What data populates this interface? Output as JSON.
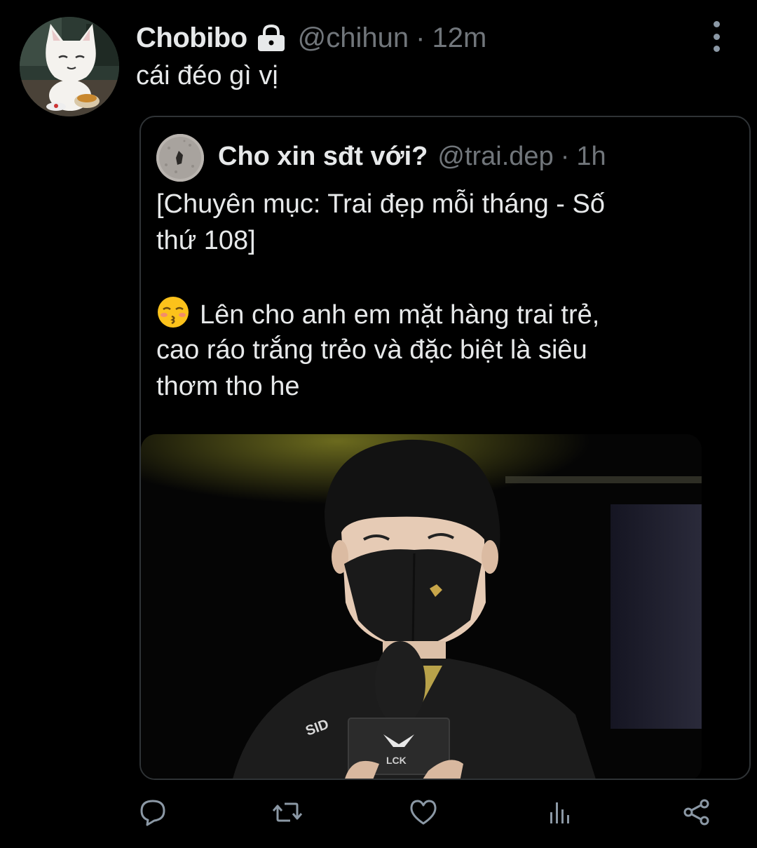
{
  "tweet": {
    "display_name": "Chobibo",
    "handle": "@chihun",
    "separator": "·",
    "time": "12m",
    "text": "cái đéo gì vị",
    "protected_icon": "lock-icon",
    "more_icon": "more-vertical-icon"
  },
  "quoted_tweet": {
    "display_name": "Cho xin sđt với?",
    "handle": "@trai.dep",
    "separator": "·",
    "time": "1h",
    "lines": [
      "[Chuyên mục: Trai đẹp mỗi tháng - Số",
      "thứ 108]",
      "",
      "Lên cho anh em mặt hàng trai trẻ,",
      "cao ráo trắng trẻo và đặc biệt là siêu",
      "thơm tho he"
    ],
    "emoji": "kissing-face-with-closed-eyes",
    "media": "photo"
  },
  "actions": [
    {
      "name": "reply",
      "icon": "reply-icon"
    },
    {
      "name": "retweet",
      "icon": "retweet-icon"
    },
    {
      "name": "like",
      "icon": "heart-icon"
    },
    {
      "name": "analytics",
      "icon": "analytics-icon"
    },
    {
      "name": "share",
      "icon": "share-icon"
    }
  ],
  "colors": {
    "background": "#000000",
    "text_primary": "#e7e9ea",
    "text_secondary": "#71767b",
    "border": "#2f3336",
    "icon": "#8b98a5"
  }
}
